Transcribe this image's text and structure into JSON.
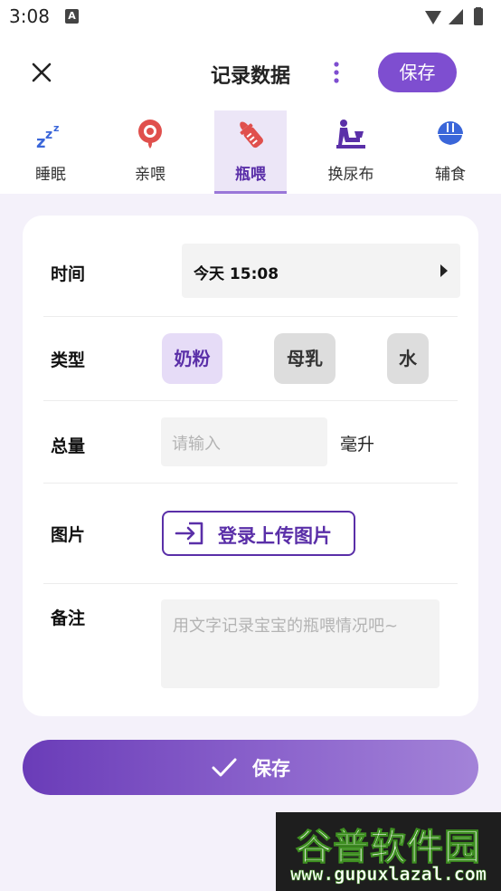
{
  "status_bar": {
    "time": "3:08",
    "notification_letter": "A"
  },
  "app_bar": {
    "title": "记录数据",
    "save_label": "保存"
  },
  "tabs": [
    {
      "label": "睡眠",
      "icon": "sleep-zzz-icon"
    },
    {
      "label": "亲喂",
      "icon": "breastfeeding-icon"
    },
    {
      "label": "瓶喂",
      "icon": "baby-bottle-icon",
      "active": true
    },
    {
      "label": "换尿布",
      "icon": "diaper-change-icon"
    },
    {
      "label": "辅食",
      "icon": "food-bowl-icon"
    }
  ],
  "form": {
    "time": {
      "label": "时间",
      "value": "今天 15:08"
    },
    "type": {
      "label": "类型",
      "options": [
        "奶粉",
        "母乳",
        "水"
      ],
      "selected": "奶粉"
    },
    "amount": {
      "label": "总量",
      "placeholder": "请输入",
      "unit": "毫升"
    },
    "image": {
      "label": "图片",
      "button_label": "登录上传图片"
    },
    "note": {
      "label": "备注",
      "placeholder": "用文字记录宝宝的瓶喂情况吧~"
    }
  },
  "bottom_button": {
    "label": "保存"
  },
  "watermark": {
    "title": "谷普软件园",
    "url": "www.gupuxlazal.com"
  },
  "colors": {
    "accent": "#7e4ed0",
    "accent_dark": "#5a2fa8",
    "tab_icon_blue": "#3a66d9",
    "tab_icon_red": "#e0504d",
    "background": "#f4f1fa"
  }
}
